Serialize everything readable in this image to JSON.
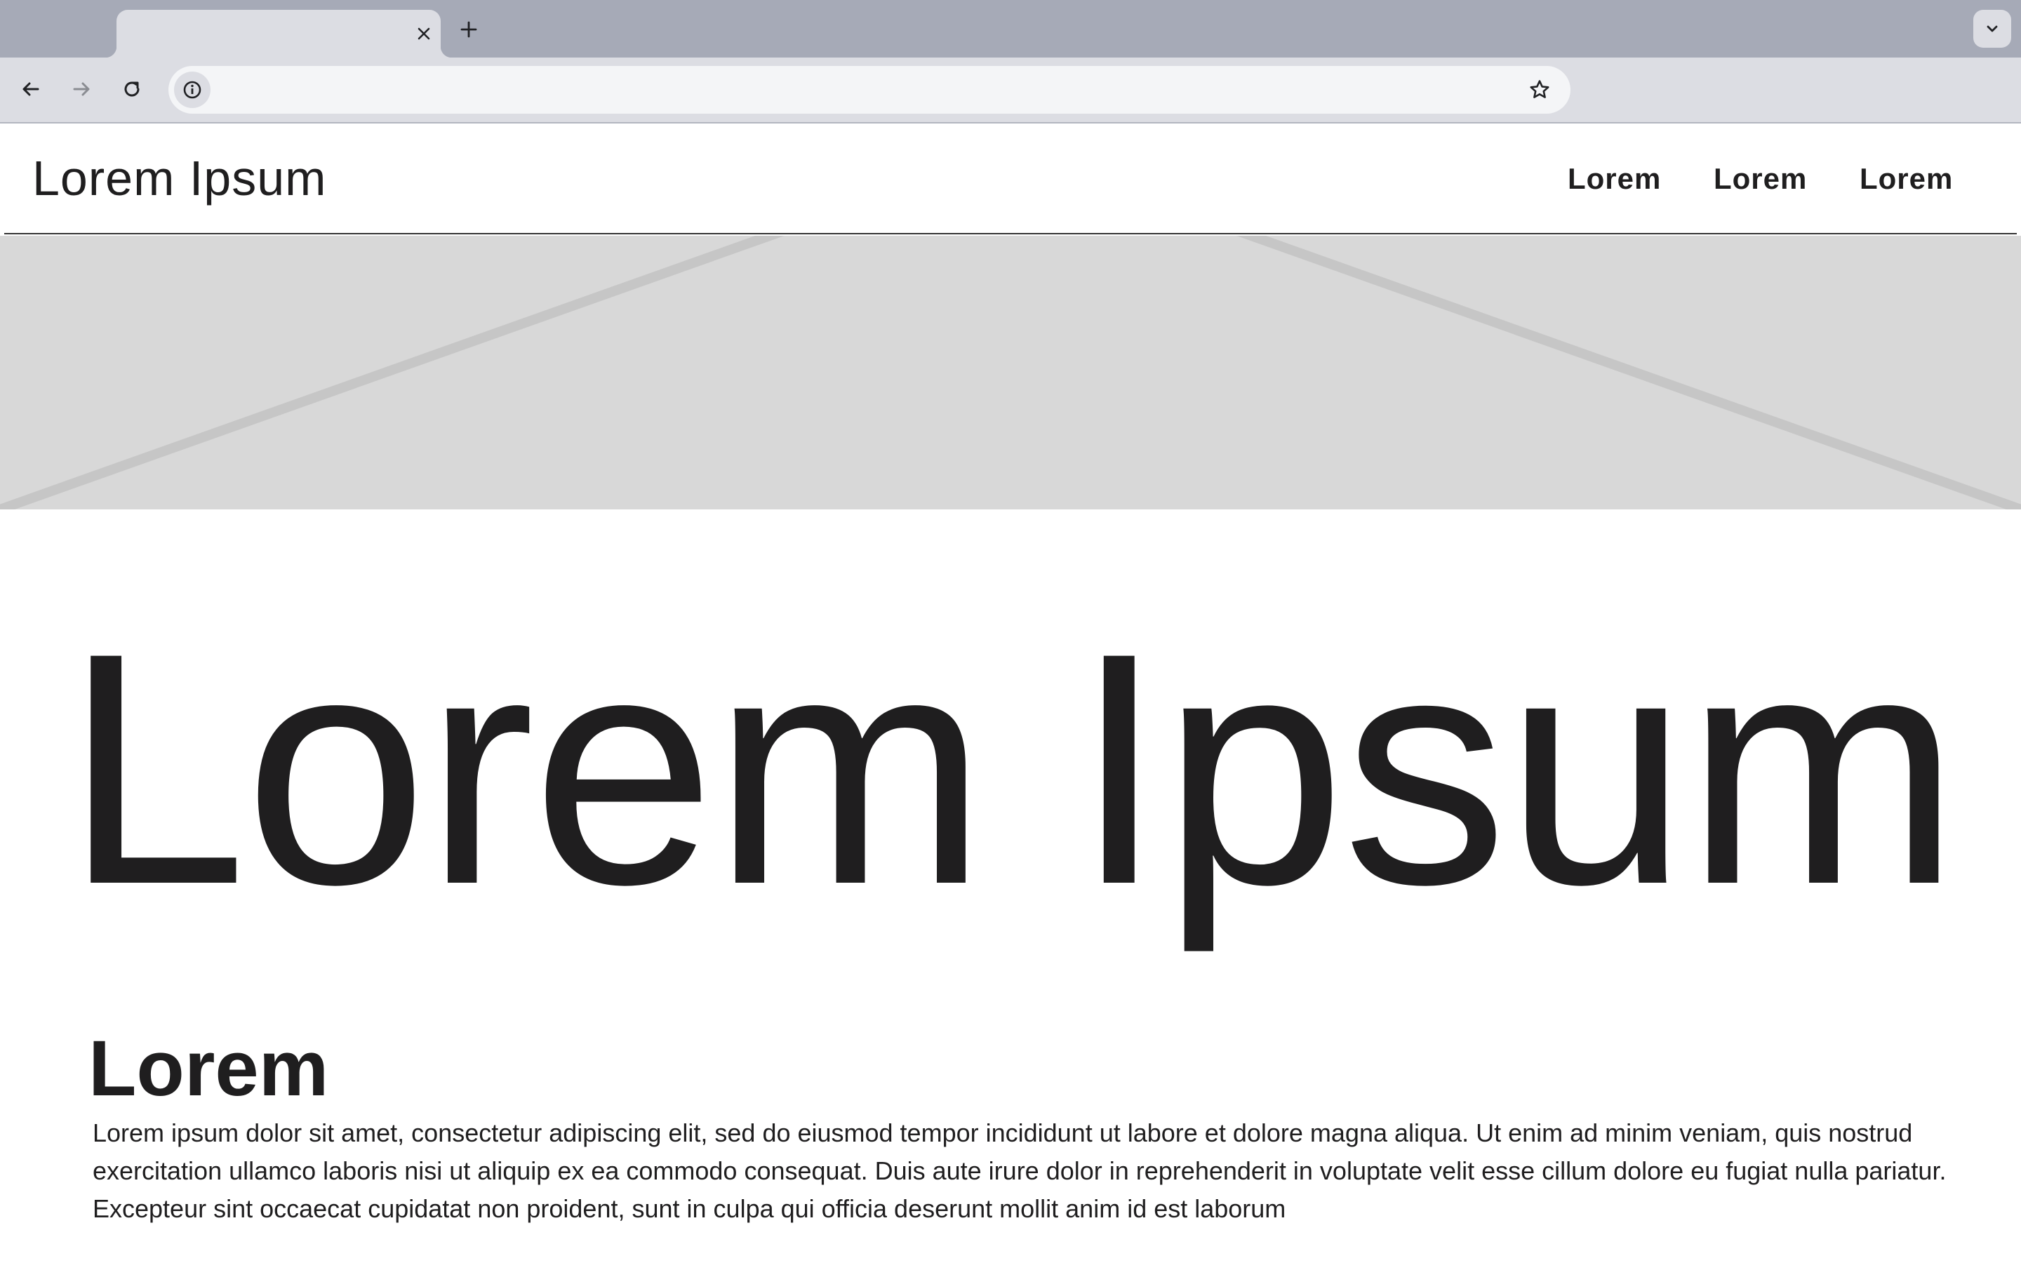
{
  "browser": {
    "tab_title": "",
    "tab_close_icon": "close-icon",
    "new_tab_icon": "plus-icon",
    "tab_search_icon": "chevron-down-icon",
    "url": "",
    "back_icon": "arrow-left-icon",
    "forward_icon": "arrow-right-icon",
    "reload_icon": "reload-icon",
    "site_info_icon": "info-icon",
    "bookmark_icon": "star-icon"
  },
  "site": {
    "logo": "Lorem Ipsum",
    "nav": [
      {
        "label": "Lorem"
      },
      {
        "label": "Lorem"
      },
      {
        "label": "Lorem"
      }
    ]
  },
  "hero": {
    "title": "Lorem Ipsum"
  },
  "section": {
    "heading": "Lorem",
    "body": "Lorem ipsum dolor sit amet, consectetur adipiscing elit, sed do eiusmod tempor incididunt ut labore et dolore magna aliqua. Ut enim ad minim veniam, quis nostrud exercitation ullamco laboris nisi ut aliquip ex ea commodo consequat. Duis aute irure dolor in reprehenderit in voluptate velit esse cillum dolore eu fugiat nulla pariatur. Excepteur sint occaecat cupidatat non proident, sunt in culpa qui officia deserunt mollit anim id est laborum"
  },
  "colors": {
    "tabstrip": "#a6aab7",
    "toolbar": "#dcdde3",
    "omnibox": "#f4f5f7",
    "placeholder_bg": "#d8d8d8",
    "placeholder_lines": "#c6c6c6",
    "text": "#1f1e1f"
  }
}
